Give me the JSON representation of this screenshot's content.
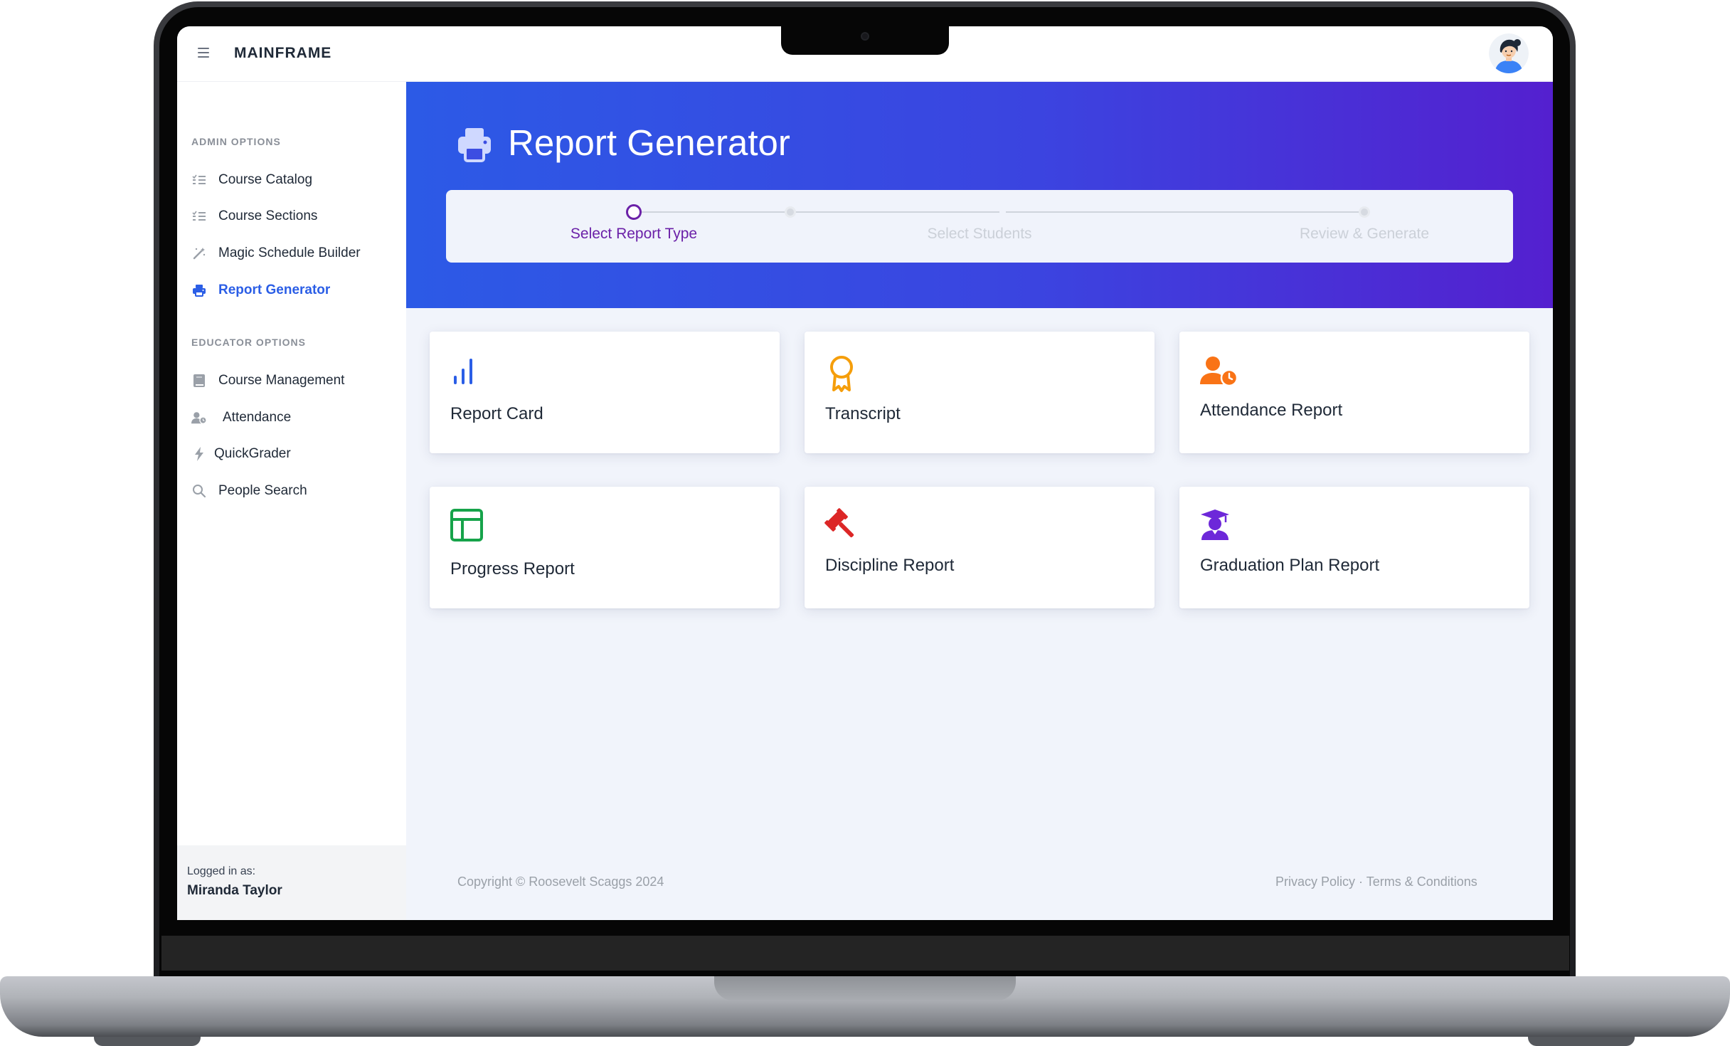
{
  "app": {
    "brand": "MAINFRAME"
  },
  "sidebar": {
    "admin_section": "ADMIN OPTIONS",
    "admin_items": [
      {
        "label": "Course Catalog",
        "icon": "list-icon"
      },
      {
        "label": "Course Sections",
        "icon": "list-icon"
      },
      {
        "label": "Magic Schedule Builder",
        "icon": "magic-wand-icon"
      },
      {
        "label": "Report Generator",
        "icon": "printer-icon",
        "active": true
      }
    ],
    "educator_section": "EDUCATOR OPTIONS",
    "educator_items": [
      {
        "label": "Course Management",
        "icon": "book-icon"
      },
      {
        "label": "Attendance",
        "icon": "user-clock-icon"
      },
      {
        "label": "QuickGrader",
        "icon": "lightning-icon"
      },
      {
        "label": "People Search",
        "icon": "search-icon"
      }
    ],
    "footer": {
      "label": "Logged in as:",
      "user": "Miranda Taylor"
    }
  },
  "hero": {
    "title": "Report Generator",
    "icon": "printer-icon"
  },
  "stepper": {
    "steps": [
      {
        "label": "Select Report Type",
        "state": "current"
      },
      {
        "label": "Select Students",
        "state": "upcoming"
      },
      {
        "label": "Review & Generate",
        "state": "upcoming"
      }
    ]
  },
  "report_types": [
    {
      "label": "Report Card",
      "icon": "bar-chart-icon",
      "color": "#2b5ee6"
    },
    {
      "label": "Transcript",
      "icon": "award-ribbon-icon",
      "color": "#f59e0b"
    },
    {
      "label": "Attendance Report",
      "icon": "user-clock-icon",
      "color": "#f97316"
    },
    {
      "label": "Progress Report",
      "icon": "layout-panel-icon",
      "color": "#16a34a"
    },
    {
      "label": "Discipline Report",
      "icon": "gavel-icon",
      "color": "#dc2626"
    },
    {
      "label": "Graduation Plan Report",
      "icon": "graduate-icon",
      "color": "#6d28d9"
    }
  ],
  "footer": {
    "copyright": "Copyright © Roosevelt Scaggs 2024",
    "privacy": "Privacy Policy",
    "separator": "·",
    "terms": "Terms & Conditions"
  },
  "colors": {
    "accent": "#2b5ee6",
    "hero_start": "#2c5ae6",
    "hero_end": "#5420cf",
    "step_current": "#6b21a8"
  }
}
